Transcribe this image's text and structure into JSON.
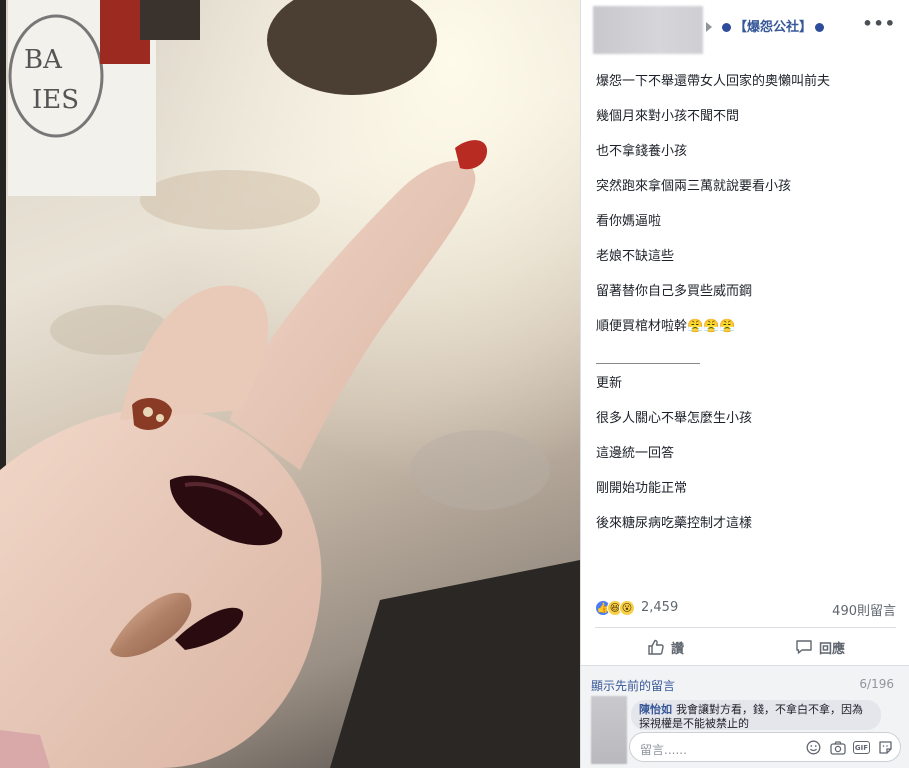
{
  "header": {
    "group_name": "【爆怨公社】",
    "more_label": "•••"
  },
  "post": {
    "lines": [
      "爆怨一下不舉還帶女人回家的奧懶叫前夫",
      "幾個月來對小孩不聞不問",
      "也不拿錢養小孩",
      "突然跑來拿個兩三萬就說要看小孩",
      "看你媽逼啦",
      "老娘不缺這些",
      "留著替你自己多買些威而鋼",
      "順便買棺材啦幹😤😤😤"
    ],
    "divider": "＿＿＿＿＿＿＿＿",
    "update_lines": [
      "更新",
      "很多人關心不舉怎麼生小孩",
      "這邊統一回答",
      "剛開始功能正常",
      "後來糖尿病吃藥控制才這樣"
    ]
  },
  "stats": {
    "reaction_icons": [
      "like-icon",
      "haha-icon",
      "wow-icon"
    ],
    "reaction_count": "2,459",
    "comment_count": "490則留言"
  },
  "actions": {
    "like_label": "讚",
    "comment_label": "回應"
  },
  "comments": {
    "show_previous": "顯示先前的留言",
    "page_count": "6/196",
    "first": {
      "author": "陳怡如",
      "text": "我會讓對方看，錢，不拿白不拿，因為探視權是不能被禁止的"
    },
    "input_placeholder": "留言......",
    "input_icons": [
      "emoji-icon",
      "camera-icon",
      "gif-icon",
      "sticker-icon"
    ]
  },
  "colors": {
    "link_blue": "#365899",
    "text": "#1d2129",
    "muted": "#606770",
    "like_blue": "#4a7cf6"
  }
}
